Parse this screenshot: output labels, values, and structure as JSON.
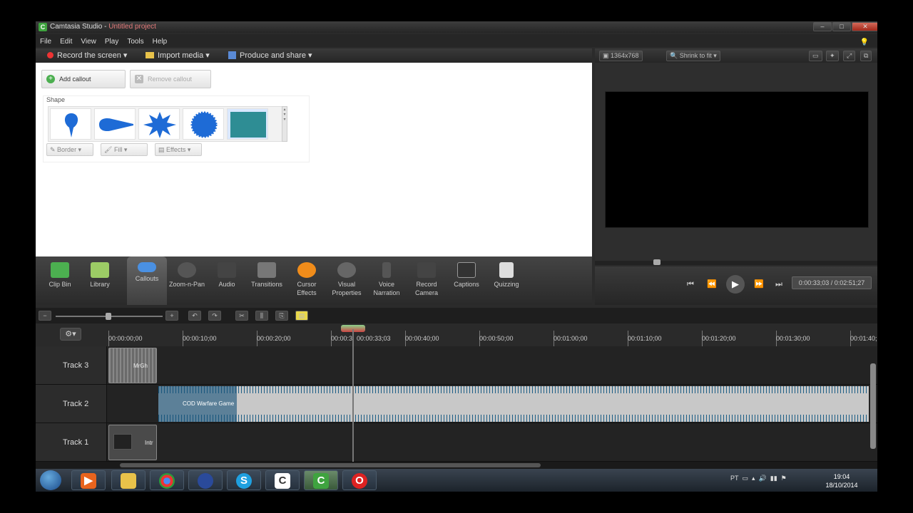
{
  "window": {
    "title_app": "Camtasia Studio - ",
    "title_project": "Untitled project",
    "min": "–",
    "max": "□",
    "close": "✕"
  },
  "menu": [
    "File",
    "Edit",
    "View",
    "Play",
    "Tools",
    "Help"
  ],
  "toolbar": {
    "record": "Record the screen ▾",
    "import": "Import media ▾",
    "produce": "Produce and share ▾"
  },
  "preview_toolbar": {
    "size": "1364x768",
    "zoom": "Shrink to fit ▾"
  },
  "callouts": {
    "add": "Add callout",
    "remove": "Remove callout",
    "shape_label": "Shape",
    "border": "Border ▾",
    "fill": "Fill ▾",
    "effects": "Effects ▾"
  },
  "shapes": [
    {
      "icon": "pin-callout-icon"
    },
    {
      "icon": "cone-callout-icon"
    },
    {
      "icon": "burst-callout-icon"
    },
    {
      "icon": "seal-callout-icon"
    },
    {
      "icon": "rectangle-callout-icon",
      "color": "#2e8d94"
    }
  ],
  "tabs": [
    {
      "label": "Clip Bin",
      "color": "#4caf50"
    },
    {
      "label": "Library",
      "color": "#9ccc65"
    },
    {
      "label": "Callouts",
      "color": "#4a90e2"
    },
    {
      "label": "Zoom-n-Pan",
      "color": "#555"
    },
    {
      "label": "Audio",
      "color": "#444"
    },
    {
      "label": "Transitions",
      "color": "#777"
    },
    {
      "label": "Cursor Effects",
      "color": "#f08c1a"
    },
    {
      "label": "Visual Properties",
      "color": "#666"
    },
    {
      "label": "Voice Narration",
      "color": "#555"
    },
    {
      "label": "Record Camera",
      "color": "#444"
    },
    {
      "label": "Captions",
      "color": "#333"
    },
    {
      "label": "Quizzing",
      "color": "#ddd"
    }
  ],
  "player": {
    "timecode": "0:00:33;03 / 0:02:51;27"
  },
  "timeline": {
    "ticks": [
      "00:00:00;00",
      "00:00:10;00",
      "00:00:20;00",
      "00:00:3",
      "00:00:3",
      "00:00:40;00",
      "00:00:50;00",
      "00:01:00;00",
      "00:01:10;00",
      "00:01:20;00",
      "00:01:30;00",
      "00:01:40;"
    ],
    "playhead_time": "00:00:33;03",
    "tracks": [
      {
        "label": "Track 3",
        "clip": "MrGh"
      },
      {
        "label": "Track 2",
        "clip": "COD Warfare Game"
      },
      {
        "label": "Track 1",
        "clip": "Intr"
      }
    ]
  },
  "taskbar": {
    "lang": "PT",
    "time": "19:04",
    "date": "18/10/2014"
  }
}
